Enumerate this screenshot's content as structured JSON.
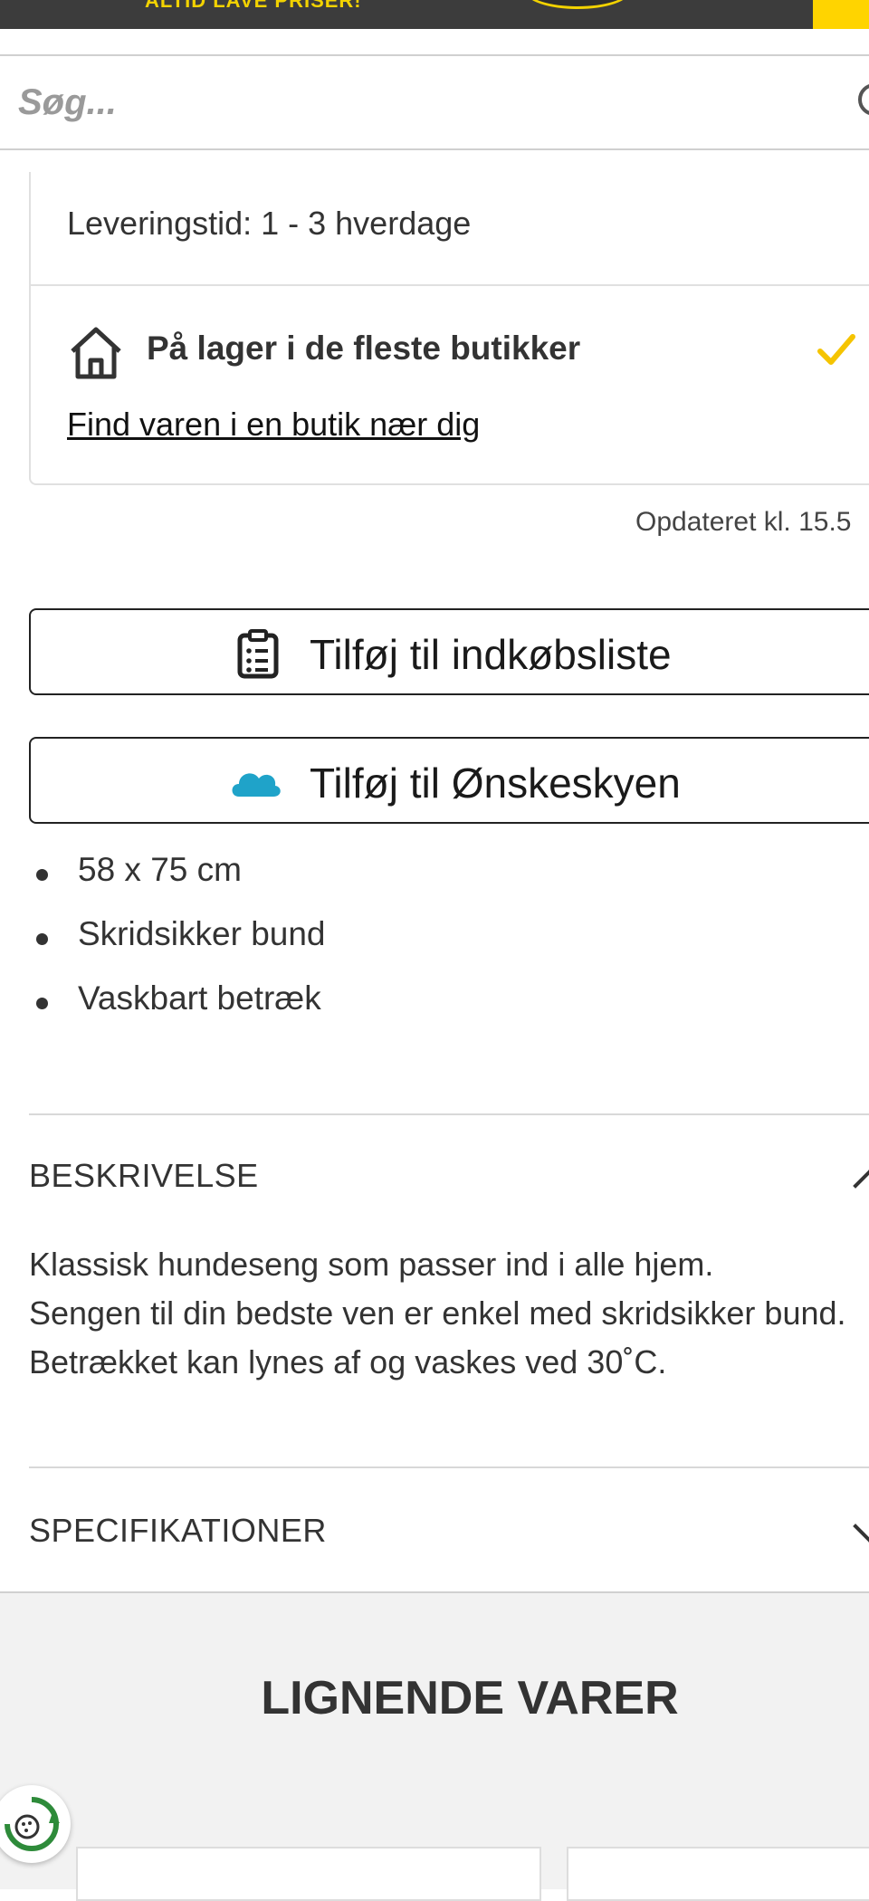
{
  "header": {
    "slogan": "ALTID LAVE PRISER!"
  },
  "search": {
    "placeholder": "Søg..."
  },
  "stock": {
    "delivery_time": "Leveringstid: 1 - 3 hverdage",
    "store_status": "På lager i de fleste butikker",
    "find_store_link": "Find varen i en butik nær dig",
    "updated": "Opdateret kl. 15.5"
  },
  "actions": {
    "add_to_list": "Tilføj til indkøbsliste",
    "add_to_wishcloud": "Tilføj til Ønskeskyen"
  },
  "features": [
    "58 x 75 cm",
    "Skridsikker bund",
    "Vaskbart betræk"
  ],
  "description": {
    "heading": "BESKRIVELSE",
    "lines": [
      "Klassisk hundeseng som passer ind i alle hjem.",
      "Sengen til din bedste ven er enkel med skridsikker bund.",
      "Betrækket kan lynes af og vaskes ved 30˚C."
    ]
  },
  "specifications": {
    "heading": "SPECIFIKATIONER"
  },
  "similar": {
    "heading": "LIGNENDE VARER"
  },
  "colors": {
    "brand_yellow": "#ffd400",
    "check": "#f5c400",
    "cloud": "#1fa3c9",
    "eco_green": "#2e8b3a"
  },
  "icons": [
    "search-icon",
    "store-icon",
    "checkmark-icon",
    "clipboard-icon",
    "cloud-icon",
    "chevron-up-icon",
    "chevron-down-icon",
    "eco-badge-icon"
  ]
}
